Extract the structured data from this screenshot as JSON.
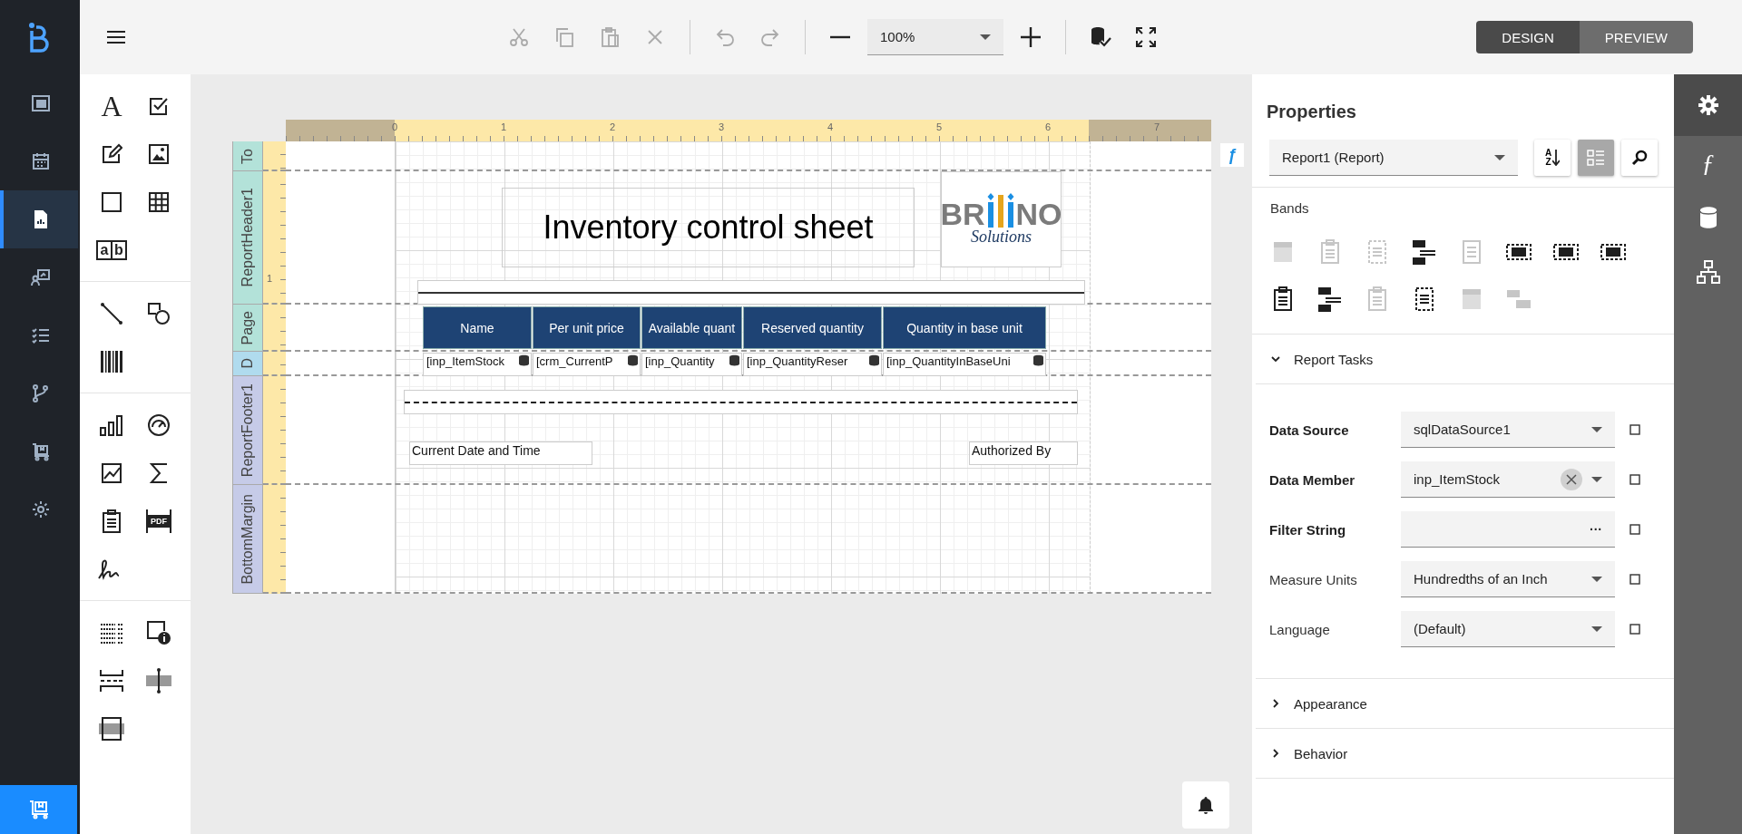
{
  "nav_items": [
    {
      "selected": false
    },
    {
      "selected": false
    },
    {
      "selected": true
    },
    {
      "selected": false
    },
    {
      "selected": false
    },
    {
      "selected": false
    },
    {
      "selected": false
    },
    {
      "selected": false
    }
  ],
  "toolbar": {
    "actions": [
      {
        "disabled": true
      },
      {
        "disabled": true
      },
      {
        "disabled": true
      },
      {
        "disabled": true
      },
      {
        "disabled": true
      },
      {
        "disabled": true
      }
    ],
    "zoom": "100%",
    "modes": [
      {
        "label": "DESIGN",
        "selected": true
      },
      {
        "label": "PREVIEW",
        "selected": false
      }
    ]
  },
  "toolbox": {
    "label_glyph": "A",
    "comb_glyphs": [
      "a",
      "b"
    ],
    "pdf_glyph": "PDF"
  },
  "report": {
    "ruler_labels": [
      "0",
      "1",
      "2",
      "3",
      "4",
      "5",
      "6",
      "7"
    ],
    "bands": [
      {
        "name": "To",
        "color": "#b3e2d9"
      },
      {
        "name": "ReportHeader1",
        "color": "#b3e2d9",
        "ruler_mark": "1"
      },
      {
        "name": "Page",
        "color": "#b3e2d9"
      },
      {
        "name": "D",
        "color": "#b0dbee"
      },
      {
        "name": "ReportFooter1",
        "color": "#c6cbe8"
      },
      {
        "name": "BottomMargin",
        "color": "#c6cbe8"
      }
    ],
    "title": "Inventory control sheet",
    "logo": {
      "left": "BR",
      "right": "NO",
      "tagline": "Solutions"
    },
    "columns": [
      "Name",
      "Per unit price",
      "Available quant",
      "Reserved quantity",
      "Quantity in base unit"
    ],
    "cells": [
      "[inp_ItemStock",
      "[crm_CurrentP",
      "[inp_Quantity",
      "[inp_QuantityReser",
      "[inp_QuantityInBaseUni"
    ],
    "footer_left": "Current Date and Time",
    "footer_right": "Authorized By",
    "expression_button": "ƒ"
  },
  "properties": {
    "title": "Properties",
    "object": "Report1 (Report)",
    "sort_glyphs": [
      "A",
      "Z"
    ],
    "tools": [
      {
        "selected": false
      },
      {
        "selected": true
      },
      {
        "selected": false
      }
    ],
    "bands_label": "Bands",
    "band_icons": [
      {
        "kind": "block",
        "disabled": true
      },
      {
        "kind": "clipboard",
        "disabled": true
      },
      {
        "kind": "dotted",
        "disabled": true
      },
      {
        "kind": "stack",
        "disabled": false
      },
      {
        "kind": "page",
        "disabled": true
      },
      {
        "kind": "frame",
        "disabled": false
      },
      {
        "kind": "frame",
        "disabled": false
      },
      {
        "kind": "frame",
        "disabled": false
      },
      {
        "kind": "clipboard",
        "disabled": false
      },
      {
        "kind": "stack",
        "disabled": false
      },
      {
        "kind": "clipboard",
        "disabled": true
      },
      {
        "kind": "dotted",
        "disabled": false
      },
      {
        "kind": "block",
        "disabled": true
      },
      {
        "kind": "sub",
        "disabled": true
      }
    ],
    "sections": [
      {
        "title": "Report Tasks",
        "expanded": true,
        "rows": [
          {
            "label": "Data Source",
            "bold": true,
            "kind": "select",
            "value": "sqlDataSource1"
          },
          {
            "label": "Data Member",
            "bold": true,
            "kind": "clearable",
            "value": "inp_ItemStock"
          },
          {
            "label": "Filter String",
            "bold": true,
            "kind": "editor",
            "button": "···"
          },
          {
            "label": "Measure Units",
            "bold": false,
            "kind": "select",
            "value": "Hundredths of an Inch"
          },
          {
            "label": "Language",
            "bold": false,
            "kind": "select",
            "value": "(Default)"
          }
        ]
      },
      {
        "title": "Appearance",
        "expanded": false
      },
      {
        "title": "Behavior",
        "expanded": false
      }
    ]
  },
  "side_tabs": [
    {
      "selected": true
    },
    {
      "selected": false,
      "glyph": "ƒ"
    },
    {
      "selected": false
    },
    {
      "selected": false
    }
  ]
}
